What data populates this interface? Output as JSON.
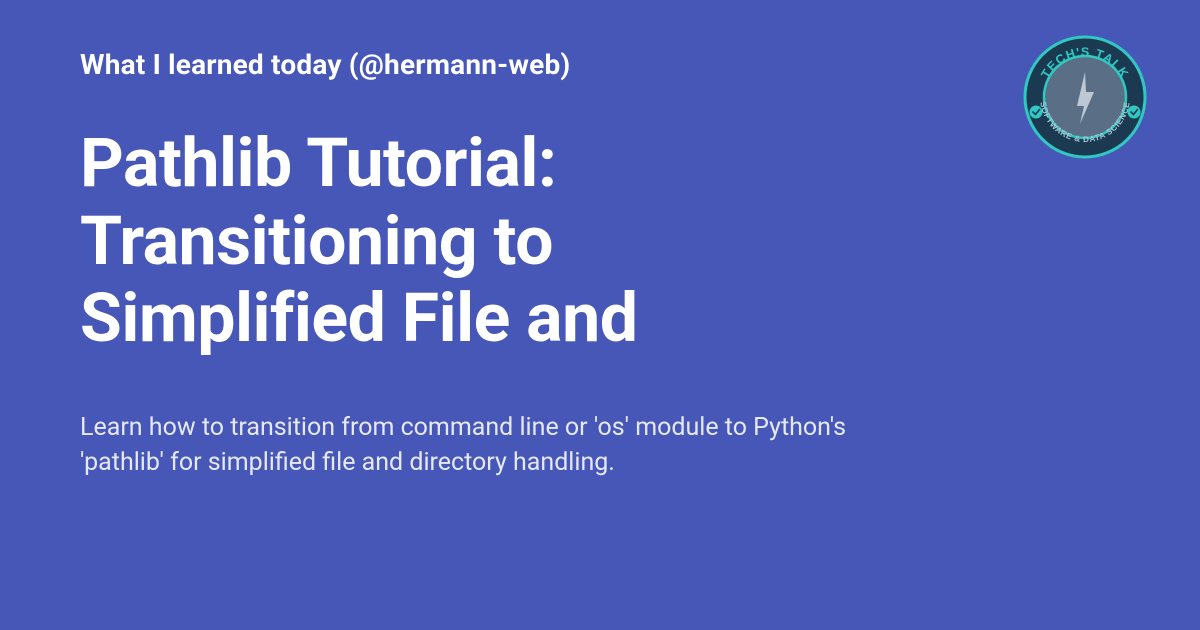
{
  "header": "What I learned today (@hermann-web)",
  "title": "Pathlib Tutorial: Transitioning to Simplified File and",
  "description": "Learn how to transition from command line or 'os' module to Python's 'pathlib' for simplified file and directory handling.",
  "badge": {
    "top_text": "TECH'S TALK",
    "bottom_text": "SOFTWARE & DATA SCIENCE"
  }
}
